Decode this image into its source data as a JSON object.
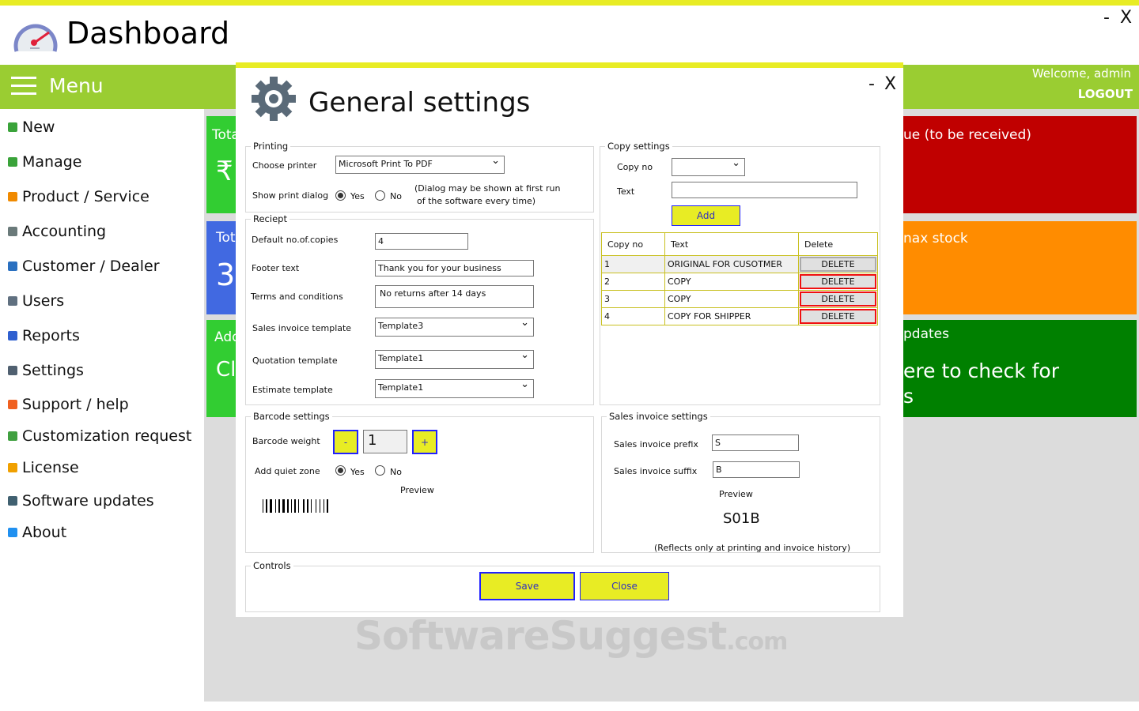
{
  "app": {
    "title": "Dashboard",
    "minimize": "-",
    "close": "X",
    "menu_label": "Menu",
    "welcome": "Welcome, admin",
    "logout": "LOGOUT"
  },
  "sidebar": {
    "items": [
      {
        "label": "New",
        "icon": "plus-circle-icon",
        "color": "#3aa33a"
      },
      {
        "label": "Manage",
        "icon": "manage-icon",
        "color": "#3aa33a"
      },
      {
        "label": "Product / Service",
        "icon": "box-icon",
        "color": "#f08a00"
      },
      {
        "label": "Accounting",
        "icon": "calculator-icon",
        "color": "#6a7a7a"
      },
      {
        "label": "Customer / Dealer",
        "icon": "customer-icon",
        "color": "#2a70c0"
      },
      {
        "label": "Users",
        "icon": "user-icon",
        "color": "#607080"
      },
      {
        "label": "Reports",
        "icon": "chart-icon",
        "color": "#3060d0"
      },
      {
        "label": "Settings",
        "icon": "gear-icon",
        "color": "#506070"
      },
      {
        "label": "Support / help",
        "icon": "support-icon",
        "color": "#f06020"
      },
      {
        "label": "Customization request",
        "icon": "puzzle-icon",
        "color": "#40a040"
      },
      {
        "label": "License",
        "icon": "key-icon",
        "color": "#f0a000"
      },
      {
        "label": "Software updates",
        "icon": "download-icon",
        "color": "#406070"
      },
      {
        "label": "About",
        "icon": "info-icon",
        "color": "#2090f0"
      }
    ]
  },
  "tiles": {
    "left": [
      {
        "title": "Tota",
        "value": "₹"
      },
      {
        "title": "Tot",
        "value": "3"
      },
      {
        "title": "Add",
        "value": "Cl"
      }
    ],
    "right": [
      {
        "title": "ue (to be received)"
      },
      {
        "title": "nax stock"
      },
      {
        "title": "pdates",
        "value": "ere to check for",
        "value2": "s"
      }
    ]
  },
  "colors": {
    "accent": "#e8ec24",
    "menu": "#9acd32",
    "tile_green": "#32cd32",
    "tile_blue": "#4169e1",
    "tile_red": "#c00000",
    "tile_orange": "#ff8c00",
    "tile_darkgreen": "#008000"
  },
  "dialog": {
    "title": "General settings",
    "minimize": "-",
    "close": "X",
    "printing": {
      "legend": "Printing",
      "printer_label": "Choose printer",
      "printer_value": "Microsoft Print To PDF",
      "dialog_label": "Show print dialog",
      "yes": "Yes",
      "no": "No",
      "note1": "(Dialog may be shown at first run",
      "note2": "of the software every time)"
    },
    "receipt": {
      "legend": "Reciept",
      "copies_label": "Default no.of.copies",
      "copies_value": "4",
      "footer_label": "Footer text",
      "footer_value": "Thank you for your business",
      "terms_label": "Terms and conditions",
      "terms_value": "No returns after 14 days",
      "sales_tpl_label": "Sales invoice template",
      "sales_tpl_value": "Template3",
      "quote_tpl_label": "Quotation template",
      "quote_tpl_value": "Template1",
      "est_tpl_label": "Estimate template",
      "est_tpl_value": "Template1"
    },
    "copy": {
      "legend": "Copy settings",
      "copyno_label": "Copy no",
      "text_label": "Text",
      "add": "Add",
      "headers": [
        "Copy no",
        "Text",
        "Delete"
      ],
      "rows": [
        {
          "no": "1",
          "text": "ORIGINAL FOR CUSOTMER",
          "del": "DELETE"
        },
        {
          "no": "2",
          "text": "COPY",
          "del": "DELETE"
        },
        {
          "no": "3",
          "text": "COPY",
          "del": "DELETE"
        },
        {
          "no": "4",
          "text": "COPY FOR SHIPPER",
          "del": "DELETE"
        }
      ]
    },
    "barcode": {
      "legend": "Barcode settings",
      "weight_label": "Barcode weight",
      "minus": "-",
      "weight_value": "1",
      "plus": "+",
      "quiet_label": "Add quiet zone",
      "yes": "Yes",
      "no": "No",
      "preview": "Preview"
    },
    "sales": {
      "legend": "Sales invoice settings",
      "prefix_label": "Sales invoice prefix",
      "prefix_value": "S",
      "suffix_label": "Sales invoice suffix",
      "suffix_value": "B",
      "preview": "Preview",
      "preview_value": "S01B",
      "note": "(Reflects only at printing and invoice history)"
    },
    "controls": {
      "legend": "Controls",
      "save": "Save",
      "close": "Close"
    }
  },
  "watermark": {
    "text": "SoftwareSuggest",
    "suffix": ".com"
  }
}
